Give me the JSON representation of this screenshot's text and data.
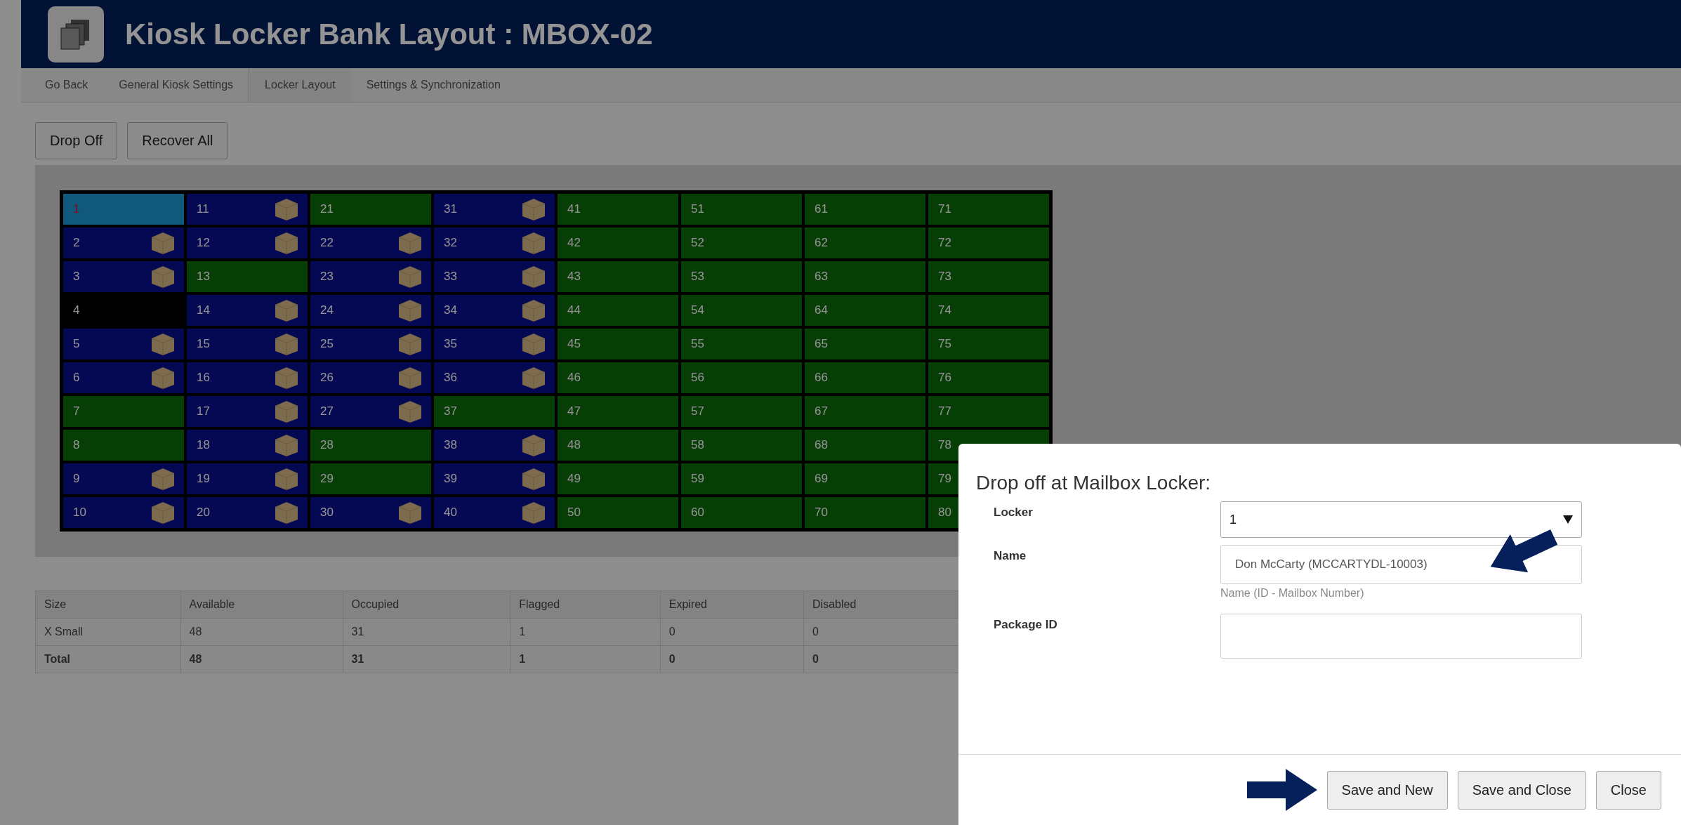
{
  "header": {
    "title": "Kiosk Locker Bank Layout : MBOX-02"
  },
  "nav": [
    {
      "label": "Go Back",
      "selected": false
    },
    {
      "label": "General Kiosk Settings",
      "selected": false
    },
    {
      "label": "Locker Layout",
      "selected": true
    },
    {
      "label": "Settings & Synchronization",
      "selected": false
    }
  ],
  "actions": [
    "Drop Off",
    "Recover All"
  ],
  "locker_rows": [
    [
      {
        "number": "1",
        "kind": "flagged"
      },
      {
        "number": "11",
        "kind": "occupied"
      },
      {
        "number": "21",
        "kind": "available"
      },
      {
        "number": "31",
        "kind": "occupied"
      },
      {
        "number": "41",
        "kind": "available"
      },
      {
        "number": "51",
        "kind": "available"
      },
      {
        "number": "61",
        "kind": "available"
      },
      {
        "number": "71",
        "kind": "available"
      }
    ],
    [
      {
        "number": "2",
        "kind": "occupied"
      },
      {
        "number": "12",
        "kind": "occupied"
      },
      {
        "number": "22",
        "kind": "occupied"
      },
      {
        "number": "32",
        "kind": "occupied"
      },
      {
        "number": "42",
        "kind": "available"
      },
      {
        "number": "52",
        "kind": "available"
      },
      {
        "number": "62",
        "kind": "available"
      },
      {
        "number": "72",
        "kind": "available"
      }
    ],
    [
      {
        "number": "3",
        "kind": "occupied"
      },
      {
        "number": "13",
        "kind": "available"
      },
      {
        "number": "23",
        "kind": "occupied"
      },
      {
        "number": "33",
        "kind": "occupied"
      },
      {
        "number": "43",
        "kind": "available"
      },
      {
        "number": "53",
        "kind": "available"
      },
      {
        "number": "63",
        "kind": "available"
      },
      {
        "number": "73",
        "kind": "available"
      }
    ],
    [
      {
        "number": "4",
        "kind": "disabled"
      },
      {
        "number": "14",
        "kind": "occupied"
      },
      {
        "number": "24",
        "kind": "occupied"
      },
      {
        "number": "34",
        "kind": "occupied"
      },
      {
        "number": "44",
        "kind": "available"
      },
      {
        "number": "54",
        "kind": "available"
      },
      {
        "number": "64",
        "kind": "available"
      },
      {
        "number": "74",
        "kind": "available"
      }
    ],
    [
      {
        "number": "5",
        "kind": "occupied"
      },
      {
        "number": "15",
        "kind": "occupied"
      },
      {
        "number": "25",
        "kind": "occupied"
      },
      {
        "number": "35",
        "kind": "occupied"
      },
      {
        "number": "45",
        "kind": "available"
      },
      {
        "number": "55",
        "kind": "available"
      },
      {
        "number": "65",
        "kind": "available"
      },
      {
        "number": "75",
        "kind": "available"
      }
    ],
    [
      {
        "number": "6",
        "kind": "occupied"
      },
      {
        "number": "16",
        "kind": "occupied"
      },
      {
        "number": "26",
        "kind": "occupied"
      },
      {
        "number": "36",
        "kind": "occupied"
      },
      {
        "number": "46",
        "kind": "available"
      },
      {
        "number": "56",
        "kind": "available"
      },
      {
        "number": "66",
        "kind": "available"
      },
      {
        "number": "76",
        "kind": "available"
      }
    ],
    [
      {
        "number": "7",
        "kind": "available"
      },
      {
        "number": "17",
        "kind": "occupied"
      },
      {
        "number": "27",
        "kind": "occupied"
      },
      {
        "number": "37",
        "kind": "available"
      },
      {
        "number": "47",
        "kind": "available"
      },
      {
        "number": "57",
        "kind": "available"
      },
      {
        "number": "67",
        "kind": "available"
      },
      {
        "number": "77",
        "kind": "available"
      }
    ],
    [
      {
        "number": "8",
        "kind": "available"
      },
      {
        "number": "18",
        "kind": "occupied"
      },
      {
        "number": "28",
        "kind": "available"
      },
      {
        "number": "38",
        "kind": "occupied"
      },
      {
        "number": "48",
        "kind": "available"
      },
      {
        "number": "58",
        "kind": "available"
      },
      {
        "number": "68",
        "kind": "available"
      },
      {
        "number": "78",
        "kind": "available"
      }
    ],
    [
      {
        "number": "9",
        "kind": "occupied"
      },
      {
        "number": "19",
        "kind": "occupied"
      },
      {
        "number": "29",
        "kind": "available"
      },
      {
        "number": "39",
        "kind": "occupied"
      },
      {
        "number": "49",
        "kind": "available"
      },
      {
        "number": "59",
        "kind": "available"
      },
      {
        "number": "69",
        "kind": "available"
      },
      {
        "number": "79",
        "kind": "available"
      }
    ],
    [
      {
        "number": "10",
        "kind": "occupied"
      },
      {
        "number": "20",
        "kind": "occupied"
      },
      {
        "number": "30",
        "kind": "occupied"
      },
      {
        "number": "40",
        "kind": "occupied"
      },
      {
        "number": "50",
        "kind": "available"
      },
      {
        "number": "60",
        "kind": "available"
      },
      {
        "number": "70",
        "kind": "available"
      },
      {
        "number": "80",
        "kind": "available"
      }
    ]
  ],
  "summary": {
    "columns": [
      "Size",
      "Available",
      "Occupied",
      "Flagged",
      "Expired",
      "Disabled"
    ],
    "rows": [
      {
        "kind": "size",
        "cells": [
          "X Small",
          "48",
          "31",
          "1",
          "0",
          "0"
        ]
      },
      {
        "kind": "total",
        "cells": [
          "Total",
          "48",
          "31",
          "1",
          "0",
          "0"
        ]
      }
    ]
  },
  "dialog": {
    "title": "Drop off at Mailbox Locker:",
    "locker": {
      "label": "Locker",
      "value": "1"
    },
    "name": {
      "label": "Name",
      "value": "Don McCarty (MCCARTYDL-10003)",
      "hint": "Name (ID - Mailbox Number)"
    },
    "package_id": {
      "label": "Package ID"
    },
    "buttons": [
      "Save and New",
      "Save and Close",
      "Close"
    ]
  }
}
